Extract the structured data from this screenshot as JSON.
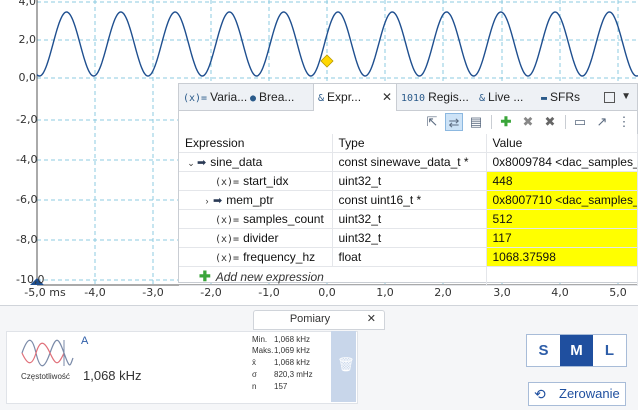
{
  "scope": {
    "y_ticks": [
      "4,0",
      "2,0",
      "0,0",
      "-2,0",
      "-4,0",
      "-6,0",
      "-8,0",
      "-10,0"
    ],
    "x_ticks": [
      "-5,0 ms",
      "-4,0",
      "-3,0",
      "-2,0",
      "-1,0",
      "0,0",
      "1,0",
      "2,0",
      "3,0",
      "4,0",
      "5,0"
    ],
    "colors": {
      "trace": "#1f4f8f",
      "grid": "#8ccbe0",
      "marker": "#ffd700"
    }
  },
  "tabs": {
    "items": [
      "Varia...",
      "Brea...",
      "Expr...",
      "Regis...",
      "Live ...",
      "SFRs"
    ],
    "icons": [
      "(x)=",
      "●",
      "&",
      "1010",
      "&",
      "▬"
    ],
    "active_index": 2,
    "close_label": "✕"
  },
  "table": {
    "headers": [
      "Expression",
      "Type",
      "Value"
    ],
    "rows": [
      {
        "name": "sine_data",
        "type": "const sinewave_data_t *",
        "value": "0x8009784 <dac_samples_...",
        "kind": "pointer",
        "expanded": true,
        "highlight": false
      },
      {
        "name": "start_idx",
        "type": "uint32_t",
        "value": "448",
        "kind": "var",
        "highlight": true
      },
      {
        "name": "mem_ptr",
        "type": "const uint16_t *",
        "value": "0x8007710 <dac_samples_...",
        "kind": "pointer",
        "expanded": false,
        "highlight": true
      },
      {
        "name": "samples_count",
        "type": "uint32_t",
        "value": "512",
        "kind": "var",
        "highlight": true
      },
      {
        "name": "divider",
        "type": "uint32_t",
        "value": "117",
        "kind": "var",
        "highlight": true
      },
      {
        "name": "frequency_hz",
        "type": "float",
        "value": "1068.37598",
        "kind": "var",
        "highlight": true
      }
    ],
    "add_label": "Add new expression",
    "fx_glyph": "(x)="
  },
  "measurements": {
    "tab_label": "Pomiary",
    "tab_close": "✕",
    "channel": "A",
    "label": "Częstotliwość",
    "value": "1,068 kHz",
    "stats": [
      {
        "key": "Min.",
        "value": "1,068 kHz"
      },
      {
        "key": "Maks.",
        "value": "1,069 kHz"
      },
      {
        "key": "x̄",
        "value": "1,068 kHz"
      },
      {
        "key": "σ",
        "value": "820,3 mHz"
      },
      {
        "key": "n",
        "value": "157"
      }
    ]
  },
  "size_selector": {
    "options": [
      "S",
      "M",
      "L"
    ],
    "selected": "M"
  },
  "reset": {
    "label": "Zerowanie"
  }
}
